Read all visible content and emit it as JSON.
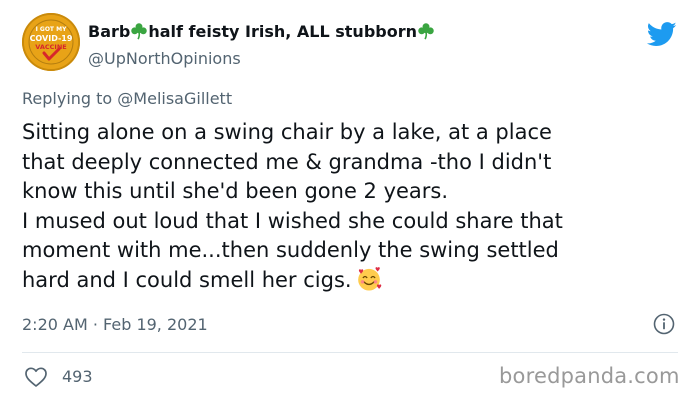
{
  "user": {
    "display_name_part1": "Barb",
    "display_name_part2": "half feisty Irish, ALL stubborn",
    "handle": "@UpNorthOpinions",
    "avatar": {
      "icon": "covid-vaccine-badge-icon",
      "line1": "I GOT MY",
      "line2": "COVID-19",
      "line3": "VACCINE"
    },
    "decoration_icon": "shamrock-icon"
  },
  "reply": {
    "prefix": "Replying to ",
    "mention": "@MelisaGillett"
  },
  "tweet": {
    "lines": [
      "Sitting alone on a swing chair by a lake, at a place",
      "that deeply connected me & grandma -tho I didn't",
      "know this until she'd been gone 2 years.",
      "I mused out loud that I wished she could share that",
      "moment with me...then suddenly the swing settled",
      "hard and I could smell her cigs."
    ],
    "emoji": "smiling-face-with-hearts-emoji"
  },
  "meta": {
    "timestamp": "2:20 AM · Feb 19, 2021",
    "info_icon": "info-icon"
  },
  "actions": {
    "like_icon": "heart-outline-icon",
    "like_count": "493"
  },
  "branding": {
    "platform_icon": "twitter-bird-icon",
    "watermark": "boredpanda.com"
  },
  "colors": {
    "primary_text": "#0f1419",
    "secondary_text": "#536471",
    "twitter_blue": "#1d9bf0",
    "shamrock_green": "#3aa541",
    "avatar_gold": "#e8a317",
    "avatar_red": "#d7262b"
  }
}
